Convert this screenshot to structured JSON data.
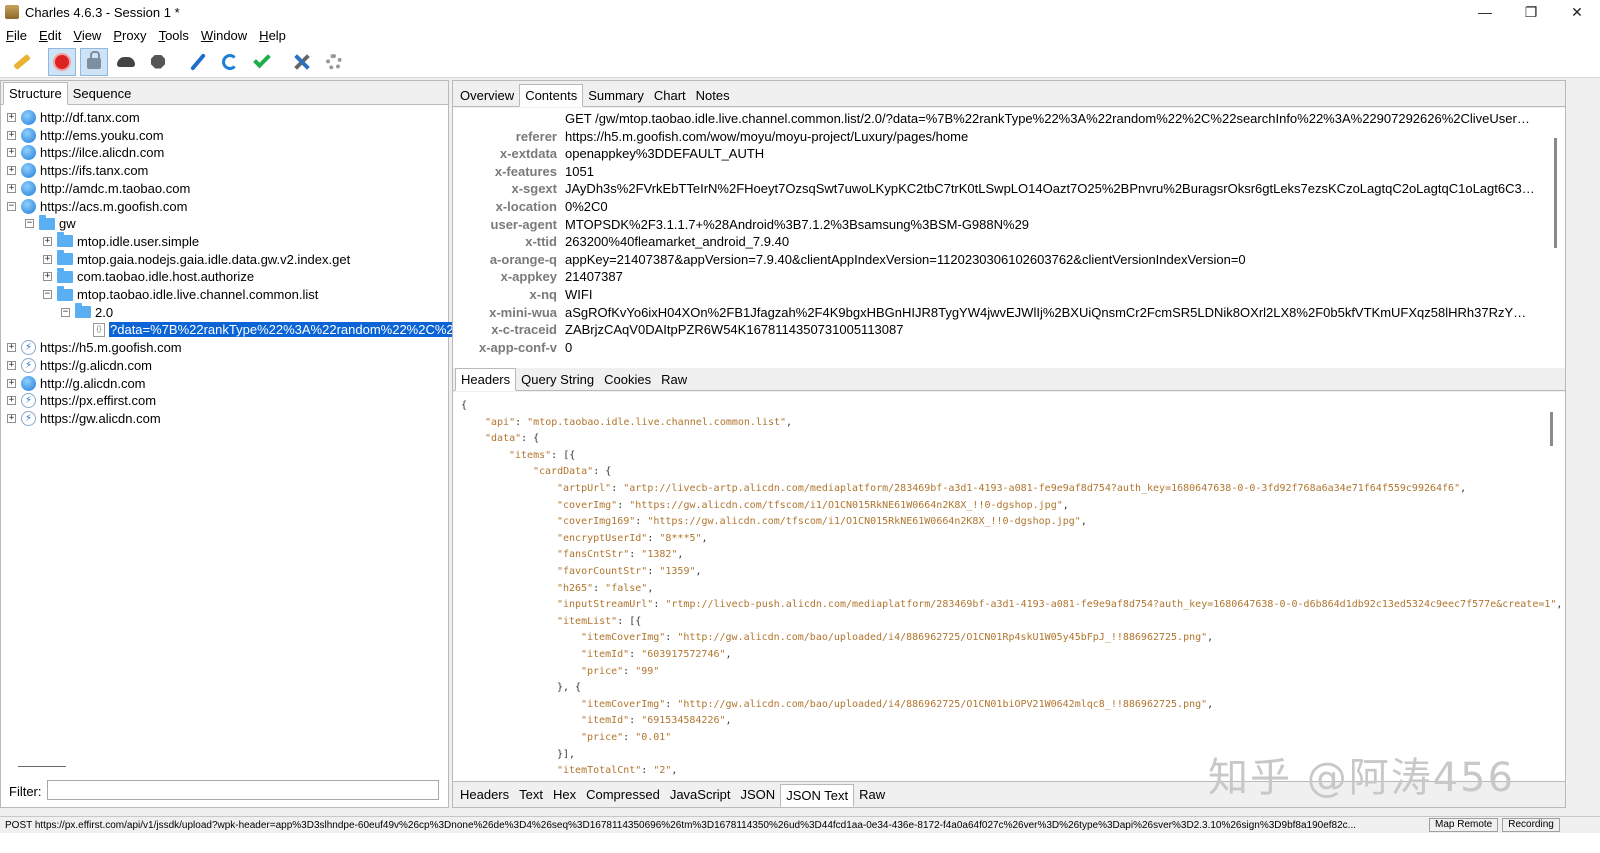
{
  "window": {
    "title": "Charles 4.6.3 - Session 1 *",
    "minimize": "—",
    "maximize": "❐",
    "close": "✕"
  },
  "menu": [
    "File",
    "Edit",
    "View",
    "Proxy",
    "Tools",
    "Window",
    "Help"
  ],
  "left": {
    "tabs": [
      "Structure",
      "Sequence"
    ],
    "active_tab": "Structure",
    "filter_label": "Filter:",
    "filter_value": ""
  },
  "tree": [
    {
      "label": "http://df.tanx.com",
      "icon": "globe-icon",
      "depth": 0,
      "exp": "+"
    },
    {
      "label": "http://ems.youku.com",
      "icon": "globe-icon",
      "depth": 0,
      "exp": "+"
    },
    {
      "label": "https://ilce.alicdn.com",
      "icon": "globe-icon",
      "depth": 0,
      "exp": "+"
    },
    {
      "label": "https://ifs.tanx.com",
      "icon": "globe-icon",
      "depth": 0,
      "exp": "+"
    },
    {
      "label": "http://amdc.m.taobao.com",
      "icon": "globe-icon",
      "depth": 0,
      "exp": "+"
    },
    {
      "label": "https://acs.m.goofish.com",
      "icon": "globe-icon",
      "depth": 0,
      "exp": "−"
    },
    {
      "label": "gw",
      "icon": "folder-icon",
      "depth": 1,
      "exp": "−"
    },
    {
      "label": "mtop.idle.user.simple",
      "icon": "folder-icon",
      "depth": 2,
      "exp": "+"
    },
    {
      "label": "mtop.gaia.nodejs.gaia.idle.data.gw.v2.index.get",
      "icon": "folder-icon",
      "depth": 2,
      "exp": "+"
    },
    {
      "label": "com.taobao.idle.host.authorize",
      "icon": "folder-icon",
      "depth": 2,
      "exp": "+"
    },
    {
      "label": "mtop.taobao.idle.live.channel.common.list",
      "icon": "folder-icon",
      "depth": 2,
      "exp": "−"
    },
    {
      "label": "2.0",
      "icon": "folder-icon",
      "depth": 3,
      "exp": "−"
    },
    {
      "label": "?data=%7B%22rankType%22%3A%22random%22%2C%2",
      "icon": "json-file-icon",
      "depth": 4,
      "exp": "",
      "selected": true
    },
    {
      "label": "https://h5.m.goofish.com",
      "icon": "bolt-icon",
      "depth": 0,
      "exp": "+"
    },
    {
      "label": "https://g.alicdn.com",
      "icon": "bolt-icon",
      "depth": 0,
      "exp": "+"
    },
    {
      "label": "http://g.alicdn.com",
      "icon": "globe-icon",
      "depth": 0,
      "exp": "+"
    },
    {
      "label": "https://px.effirst.com",
      "icon": "bolt-icon",
      "depth": 0,
      "exp": "+"
    },
    {
      "label": "https://gw.alicdn.com",
      "icon": "bolt-icon",
      "depth": 0,
      "exp": "+"
    }
  ],
  "right": {
    "tabs": [
      "Overview",
      "Contents",
      "Summary",
      "Chart",
      "Notes"
    ],
    "active_tab": "Contents",
    "header_tabs": [
      "Headers",
      "Query String",
      "Cookies",
      "Raw"
    ],
    "active_header_tab": "Headers",
    "body_tabs": [
      "Headers",
      "Text",
      "Hex",
      "Compressed",
      "JavaScript",
      "JSON",
      "JSON Text",
      "Raw"
    ],
    "active_body_tab": "JSON Text"
  },
  "headers": [
    {
      "k": "",
      "v": "GET /gw/mtop.taobao.idle.live.channel.common.list/2.0/?data=%7B%22rankType%22%3A%22random%22%2C%22searchInfo%22%3A%22907292626%2CliveUser%3B22..."
    },
    {
      "k": "referer",
      "v": "https://h5.m.goofish.com/wow/moyu/moyu-project/Luxury/pages/home"
    },
    {
      "k": "x-extdata",
      "v": "openappkey%3DDEFAULT_AUTH"
    },
    {
      "k": "x-features",
      "v": "1051"
    },
    {
      "k": "x-sgext",
      "v": "JAyDh3s%2FVrkEbTTeIrN%2FHoeyt7OzsqSwt7uwoLKypKC2tbC7trK0tLSwpLO14Oazt7O25%2BPnvru%2BuragsrOksr6gtLeks7ezsKCzoLagtqC2oLagtqC1oLagt6C3oLOgtaC3..."
    },
    {
      "k": "x-location",
      "v": "0%2C0"
    },
    {
      "k": "user-agent",
      "v": "MTOPSDK%2F3.1.1.7+%28Android%3B7.1.2%3Bsamsung%3BSM-G988N%29"
    },
    {
      "k": "x-ttid",
      "v": "263200%40fleamarket_android_7.9.40"
    },
    {
      "k": "a-orange-q",
      "v": "appKey=21407387&appVersion=7.9.40&clientAppIndexVersion=1120230306102603762&clientVersionIndexVersion=0"
    },
    {
      "k": "x-appkey",
      "v": "21407387"
    },
    {
      "k": "x-nq",
      "v": "WIFI"
    },
    {
      "k": "x-mini-wua",
      "v": "aSgROfKvYo6ixH04XOn%2FB1Jfagzah%2F4K9bgxHBGnHIJR8TygYW4jwvEJWlIj%2BXUiQnsmCr2FcmSR5LDNik8OXrl2LX8%2F0b5kfVTKmUFXqz58lHRh37RzY%2FrIi0xGdPIY..."
    },
    {
      "k": "x-c-traceid",
      "v": "ZABrjzCAqV0DAItpPZR6W54K1678114350731005113087"
    },
    {
      "k": "x-app-conf-v",
      "v": "0"
    }
  ],
  "json_lines": [
    {
      "i": 0,
      "t": "{"
    },
    {
      "i": 1,
      "k": "\"api\"",
      "v": "\"mtop.taobao.idle.live.channel.common.list\"",
      "e": ","
    },
    {
      "i": 1,
      "k": "\"data\"",
      "p": "{"
    },
    {
      "i": 2,
      "k": "\"items\"",
      "p": "[{"
    },
    {
      "i": 3,
      "k": "\"cardData\"",
      "p": "{"
    },
    {
      "i": 4,
      "k": "\"artpUrl\"",
      "v": "\"artp://livecb-artp.alicdn.com/mediaplatform/283469bf-a3d1-4193-a081-fe9e9af8d754?auth_key=1680647638-0-0-3fd92f768a6a34e71f64f559c99264f6\"",
      "e": ","
    },
    {
      "i": 4,
      "k": "\"coverImg\"",
      "v": "\"https://gw.alicdn.com/tfscom/i1/O1CN015RkNE61W0664n2K8X_!!0-dgshop.jpg\"",
      "e": ","
    },
    {
      "i": 4,
      "k": "\"coverImg169\"",
      "v": "\"https://gw.alicdn.com/tfscom/i1/O1CN015RkNE61W0664n2K8X_!!0-dgshop.jpg\"",
      "e": ","
    },
    {
      "i": 4,
      "k": "\"encryptUserId\"",
      "v": "\"8***5\"",
      "e": ","
    },
    {
      "i": 4,
      "k": "\"fansCntStr\"",
      "v": "\"1382\"",
      "e": ","
    },
    {
      "i": 4,
      "k": "\"favorCountStr\"",
      "v": "\"1359\"",
      "e": ","
    },
    {
      "i": 4,
      "k": "\"h265\"",
      "v": "\"false\"",
      "e": ","
    },
    {
      "i": 4,
      "k": "\"inputStreamUrl\"",
      "v": "\"rtmp://livecb-push.alicdn.com/mediaplatform/283469bf-a3d1-4193-a081-fe9e9af8d754?auth_key=1680647638-0-0-d6b864d1db92c13ed5324c9eec7f577e&create=1\"",
      "e": ","
    },
    {
      "i": 4,
      "k": "\"itemList\"",
      "p": "[{"
    },
    {
      "i": 5,
      "k": "\"itemCoverImg\"",
      "v": "\"http://gw.alicdn.com/bao/uploaded/i4/886962725/O1CN01Rp4skU1W05y45bFpJ_!!886962725.png\"",
      "e": ","
    },
    {
      "i": 5,
      "k": "\"itemId\"",
      "v": "\"603917572746\"",
      "e": ","
    },
    {
      "i": 5,
      "k": "\"price\"",
      "v": "\"99\""
    },
    {
      "i": 4,
      "t": "}, {"
    },
    {
      "i": 5,
      "k": "\"itemCoverImg\"",
      "v": "\"http://gw.alicdn.com/bao/uploaded/i4/886962725/O1CN01biOPV21W0642mlqc8_!!886962725.png\"",
      "e": ","
    },
    {
      "i": 5,
      "k": "\"itemId\"",
      "v": "\"691534584226\"",
      "e": ","
    },
    {
      "i": 5,
      "k": "\"price\"",
      "v": "\"0.01\""
    },
    {
      "i": 4,
      "t": "}],"
    },
    {
      "i": 4,
      "k": "\"itemTotalCnt\"",
      "v": "\"2\"",
      "e": ","
    }
  ],
  "watermark": "知乎 @阿涛456",
  "status": {
    "text": "POST https://px.effirst.com/api/v1/jssdk/upload?wpk-header=app%3D3slhndpe-60euf49v%26cp%3Dnone%26de%3D4%26seq%3D1678114350696%26tm%3D1678114350%26ud%3D44fcd1aa-0e34-436e-8172-f4a0a64f027c%26ver%3D%26type%3Dapi%26sver%3D2.3.10%26sign%3D9bf8a190ef82c...",
    "map_remote": "Map Remote",
    "recording": "Recording"
  }
}
